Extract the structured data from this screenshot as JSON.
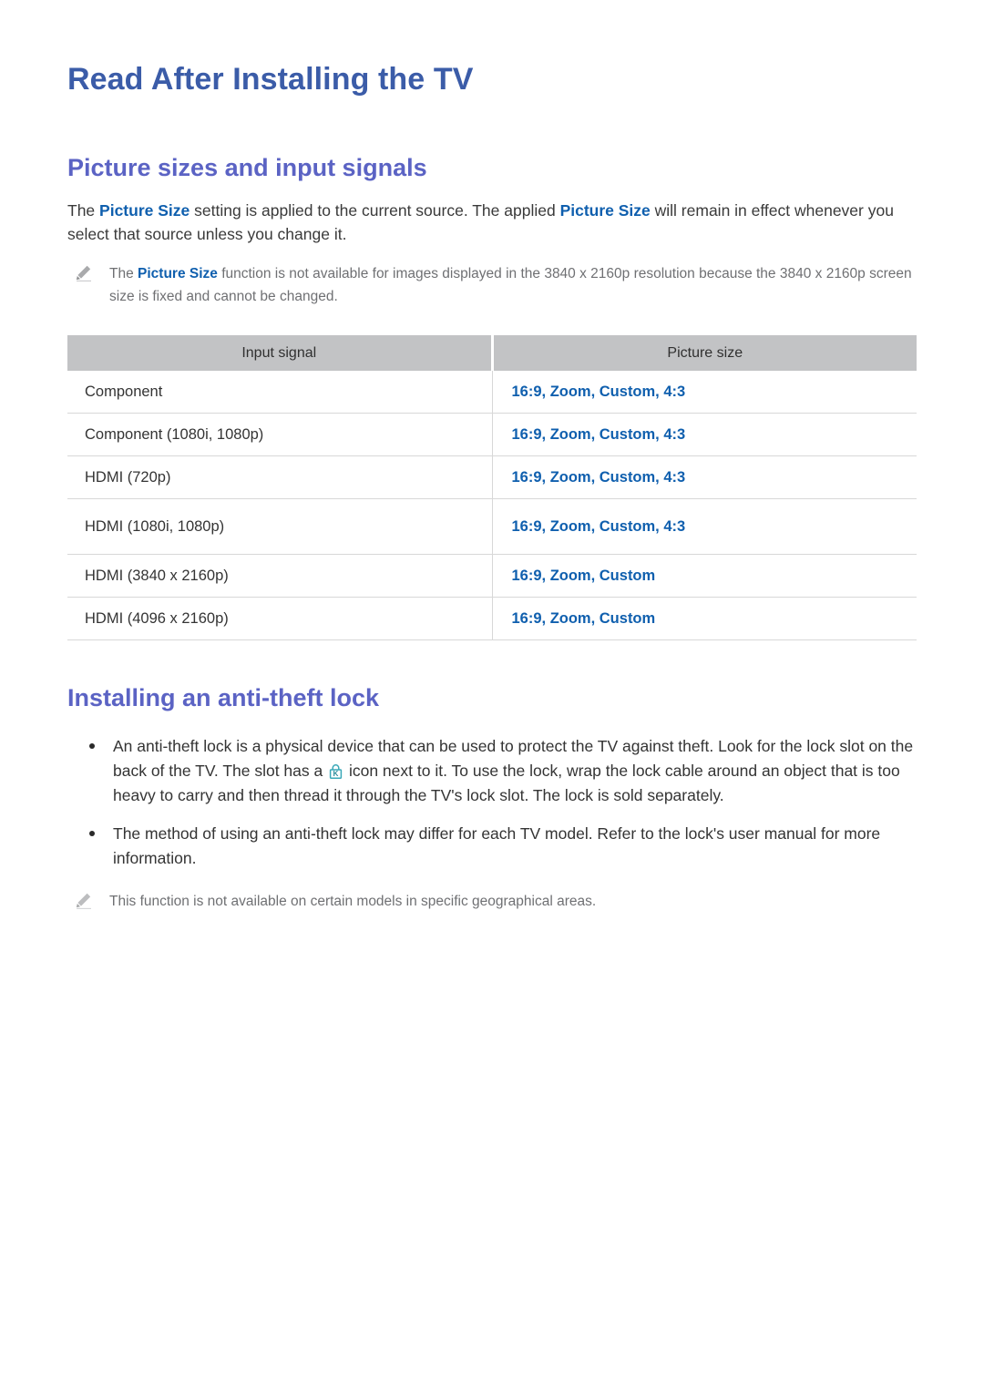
{
  "document": {
    "title": "Read After Installing the TV"
  },
  "sections": [
    {
      "heading": "Picture sizes and input signals",
      "intro": {
        "part1": "The ",
        "link1": "Picture Size",
        "part2": " setting is applied to the current source. The applied ",
        "link2": "Picture Size",
        "part3": " will remain in effect whenever you select that source unless you change it."
      },
      "note": {
        "icon": "pencil-icon",
        "part1": "The ",
        "link1": "Picture Size",
        "part2": " function is not available for images displayed in the 3840 x 2160p resolution because the 3840 x 2160p screen size is fixed and cannot be changed."
      },
      "table": {
        "headers": [
          "Input signal",
          "Picture size"
        ],
        "rows": [
          {
            "input_signal": "Component",
            "picture_size": "16:9, Zoom, Custom, 4:3"
          },
          {
            "input_signal": "Component (1080i, 1080p)",
            "picture_size": "16:9, Zoom, Custom, 4:3"
          },
          {
            "input_signal": "HDMI (720p)",
            "picture_size": "16:9, Zoom, Custom, 4:3"
          },
          {
            "input_signal": "HDMI (1080i, 1080p)",
            "picture_size": "16:9, Zoom, Custom, 4:3"
          },
          {
            "input_signal": "HDMI (3840 x 2160p)",
            "picture_size": "16:9, Zoom, Custom"
          },
          {
            "input_signal": "HDMI (4096 x 2160p)",
            "picture_size": "16:9, Zoom, Custom"
          }
        ]
      }
    },
    {
      "heading": "Installing an anti-theft lock",
      "bullets": [
        {
          "part1": "An anti-theft lock is a physical device that can be used to protect the TV against theft. Look for the lock slot on the back of the TV. The slot has a ",
          "icon": "kensington-lock-icon",
          "part2": " icon next to it. To use the lock, wrap the lock cable around an object that is too heavy to carry and then thread it through the TV's lock slot. The lock is sold separately."
        },
        {
          "part1": "The method of using an anti-theft lock may differ for each TV model. Refer to the lock's user manual for more information.",
          "icon": "",
          "part2": ""
        }
      ],
      "note": {
        "icon": "pencil-icon",
        "text": "This function is not available on certain models in specific geographical areas."
      }
    }
  ],
  "colors": {
    "doc_title": "#3b5ca8",
    "section_heading": "#5b63c4",
    "link_blue": "#0f5fae",
    "body_text": "#3a3a3a",
    "note_text": "#6f7073",
    "table_header_bg": "#c2c3c5",
    "table_border": "#d8d8d8",
    "lock_icon": "#3aa8b8",
    "page_bg": "#ffffff"
  }
}
